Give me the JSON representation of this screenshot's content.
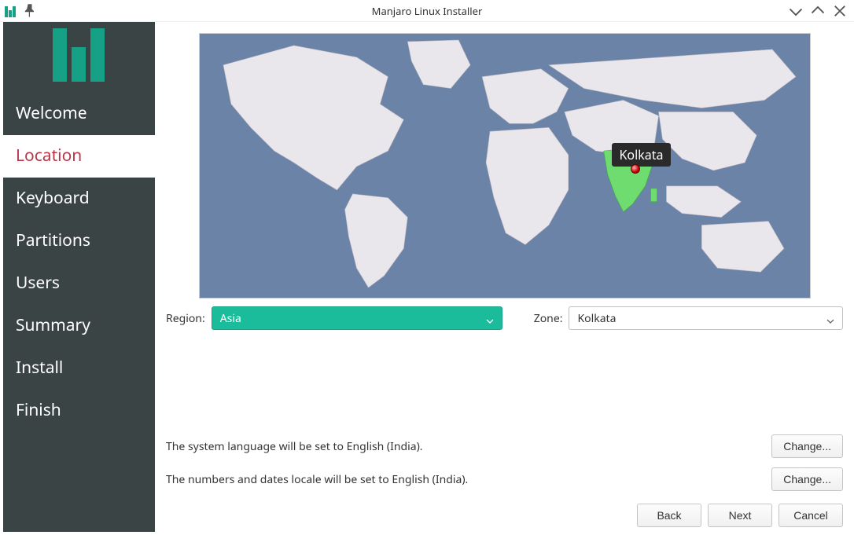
{
  "window": {
    "title": "Manjaro Linux Installer"
  },
  "sidebar": {
    "steps": [
      {
        "label": "Welcome",
        "active": false
      },
      {
        "label": "Location",
        "active": true
      },
      {
        "label": "Keyboard",
        "active": false
      },
      {
        "label": "Partitions",
        "active": false
      },
      {
        "label": "Users",
        "active": false
      },
      {
        "label": "Summary",
        "active": false
      },
      {
        "label": "Install",
        "active": false
      },
      {
        "label": "Finish",
        "active": false
      }
    ]
  },
  "map": {
    "selected_city": "Kolkata"
  },
  "form": {
    "region_label": "Region:",
    "region_value": "Asia",
    "zone_label": "Zone:",
    "zone_value": "Kolkata"
  },
  "locale": {
    "language_text": "The system language will be set to English (India).",
    "numbers_text": "The numbers and dates locale will be set to English (India).",
    "change_label": "Change..."
  },
  "buttons": {
    "back": "Back",
    "next": "Next",
    "cancel": "Cancel"
  }
}
